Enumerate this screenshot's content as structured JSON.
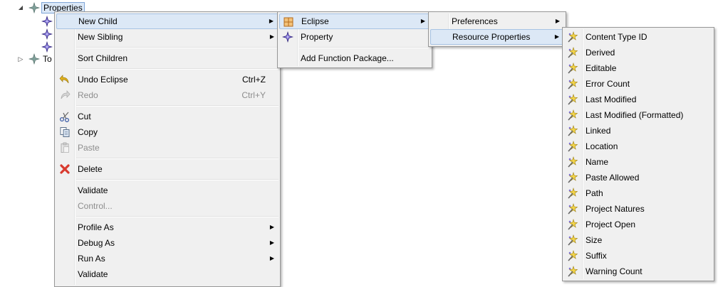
{
  "tree": {
    "root_label": "Properties",
    "sibling_label": "To"
  },
  "context_menu": {
    "items": [
      {
        "label": "New Child",
        "submenu": true
      },
      {
        "label": "New Sibling",
        "submenu": true
      },
      {
        "label": "Sort Children"
      },
      {
        "label": "Undo Eclipse",
        "accel": "Ctrl+Z"
      },
      {
        "label": "Redo",
        "accel": "Ctrl+Y",
        "disabled": true
      },
      {
        "label": "Cut"
      },
      {
        "label": "Copy"
      },
      {
        "label": "Paste",
        "disabled": true
      },
      {
        "label": "Delete"
      },
      {
        "label": "Validate"
      },
      {
        "label": "Control...",
        "disabled": true
      },
      {
        "label": "Profile As",
        "submenu": true
      },
      {
        "label": "Debug As",
        "submenu": true
      },
      {
        "label": "Run As",
        "submenu": true
      },
      {
        "label": "Validate"
      }
    ]
  },
  "new_child_menu": {
    "items": [
      {
        "label": "Eclipse",
        "submenu": true
      },
      {
        "label": "Property"
      },
      {
        "label": "Add Function Package..."
      }
    ]
  },
  "eclipse_menu": {
    "items": [
      {
        "label": "Preferences",
        "submenu": true
      },
      {
        "label": "Resource Properties",
        "submenu": true
      }
    ]
  },
  "resource_properties_menu": {
    "items": [
      {
        "label": "Content Type ID"
      },
      {
        "label": "Derived"
      },
      {
        "label": "Editable"
      },
      {
        "label": "Error Count"
      },
      {
        "label": "Last Modified"
      },
      {
        "label": "Last Modified (Formatted)"
      },
      {
        "label": "Linked"
      },
      {
        "label": "Location"
      },
      {
        "label": "Name"
      },
      {
        "label": "Paste Allowed"
      },
      {
        "label": "Path"
      },
      {
        "label": "Project Natures"
      },
      {
        "label": "Project Open"
      },
      {
        "label": "Size"
      },
      {
        "label": "Suffix"
      },
      {
        "label": "Warning Count"
      }
    ]
  },
  "colors": {
    "menu_bg": "#f0f0f0",
    "highlight": "#dce8f6",
    "delete_red": "#d83a2e",
    "undo_yellow": "#e2b21c",
    "property_purple": "#4a3aa8"
  }
}
